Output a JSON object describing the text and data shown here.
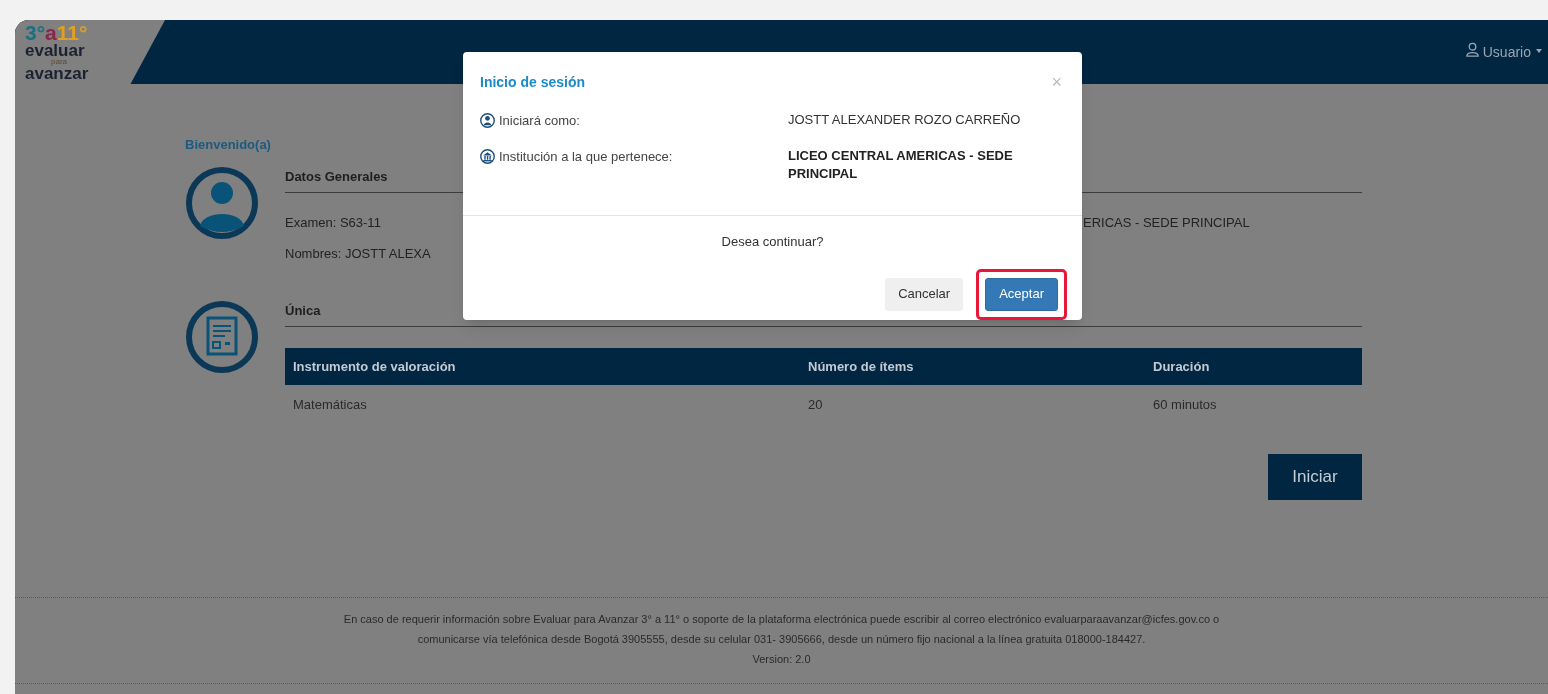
{
  "header": {
    "logo": {
      "parts": [
        {
          "text": "3°",
          "color": "#1a6f80"
        },
        {
          "text": "a",
          "color": "#8a2448"
        },
        {
          "text": "11°",
          "color": "#e0a020"
        }
      ],
      "lines": [
        "evaluar",
        "para",
        "avanzar"
      ]
    },
    "user_menu": {
      "label": "Usuario"
    }
  },
  "welcome": "Bienvenido(a)",
  "profile": {
    "title": "Datos Generales",
    "fields": [
      "Examen: S63-11",
      "ERICAS - SEDE PRINCIPAL",
      "Nombres: JOSTT ALEXA"
    ]
  },
  "exam": {
    "title": "Única",
    "table": {
      "columns": [
        "Instrumento de valoración",
        "Número de ítems",
        "Duración"
      ],
      "rows": [
        [
          "Matemáticas",
          "20",
          "60 minutos"
        ]
      ]
    },
    "start_button": "Iniciar"
  },
  "footer": {
    "lines": [
      "En caso de requerir información sobre Evaluar para Avanzar 3° a 11° o soporte de la plataforma electrónica puede escribir al correo electrónico evaluarparaavanzar@icfes.gov.co o",
      "comunicarse vía telefónica desde Bogotá 3905555, desde su celular 031- 3905666, desde un número fijo nacional a la línea gratuita 018000-184427.",
      "Version: 2.0"
    ]
  },
  "dialog": {
    "title": "Inicio de sesión",
    "close": "×",
    "rows": [
      {
        "kind": "user",
        "label": "Iniciará como:",
        "value": "JOSTT ALEXANDER ROZO CARREÑO",
        "bold": false
      },
      {
        "kind": "institution",
        "label": "Institución a la que pertenece:",
        "value": "LICEO CENTRAL AMERICAS - SEDE PRINCIPAL",
        "bold": true
      }
    ],
    "question": "Desea continuar?",
    "buttons": [
      {
        "label": "Cancelar",
        "primary": false,
        "highlighted": false
      },
      {
        "label": "Aceptar",
        "primary": true,
        "highlighted": true
      }
    ]
  }
}
